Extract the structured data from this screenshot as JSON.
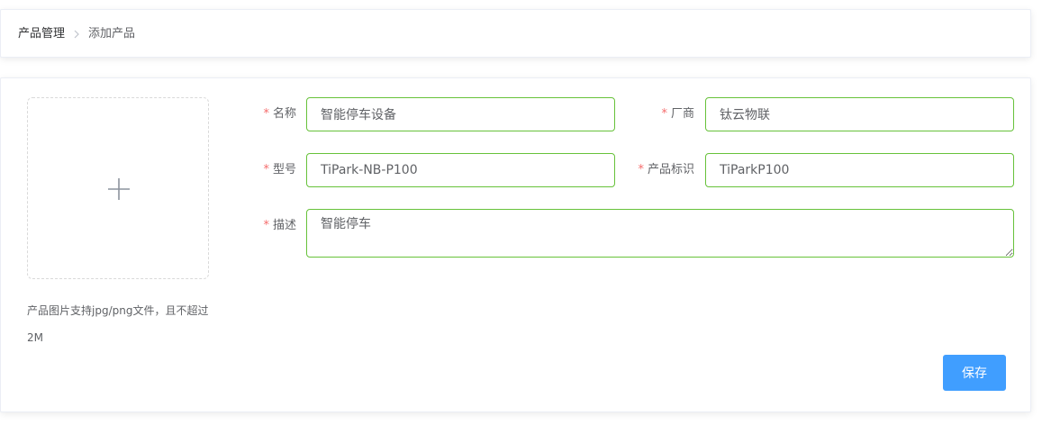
{
  "breadcrumb": {
    "items": [
      "产品管理",
      "添加产品"
    ],
    "separator_icon": "chevron-right-icon"
  },
  "upload": {
    "icon": "plus-icon",
    "tip": "产品图片支持jpg/png文件，且不超过2M"
  },
  "form": {
    "required_marker": "*",
    "name": {
      "label": "名称",
      "value": "智能停车设备"
    },
    "vendor": {
      "label": "厂商",
      "value": "钛云物联"
    },
    "model": {
      "label": "型号",
      "value": "TiPark-NB-P100"
    },
    "product_key": {
      "label": "产品标识",
      "value": "TiParkP100"
    },
    "description": {
      "label": "描述",
      "value": "智能停车"
    },
    "valid_border_color": "#67c23a",
    "required_color": "#f56c6c"
  },
  "actions": {
    "save_label": "保存",
    "save_color": "#409eff"
  }
}
